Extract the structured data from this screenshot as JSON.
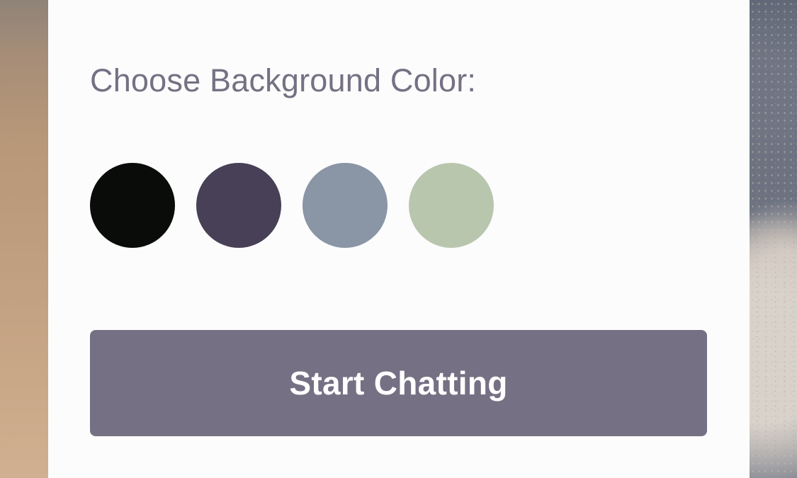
{
  "colors": {
    "panel_background": "#fcfcfd",
    "heading_text": "#757083",
    "button_background": "#757083",
    "button_text": "#ffffff"
  },
  "color_picker": {
    "heading": "Choose Background Color:",
    "swatches": [
      {
        "color": "#090c08"
      },
      {
        "color": "#474056"
      },
      {
        "color": "#8a95a5"
      },
      {
        "color": "#b9c6ae"
      }
    ]
  },
  "actions": {
    "start_label": "Start Chatting"
  }
}
